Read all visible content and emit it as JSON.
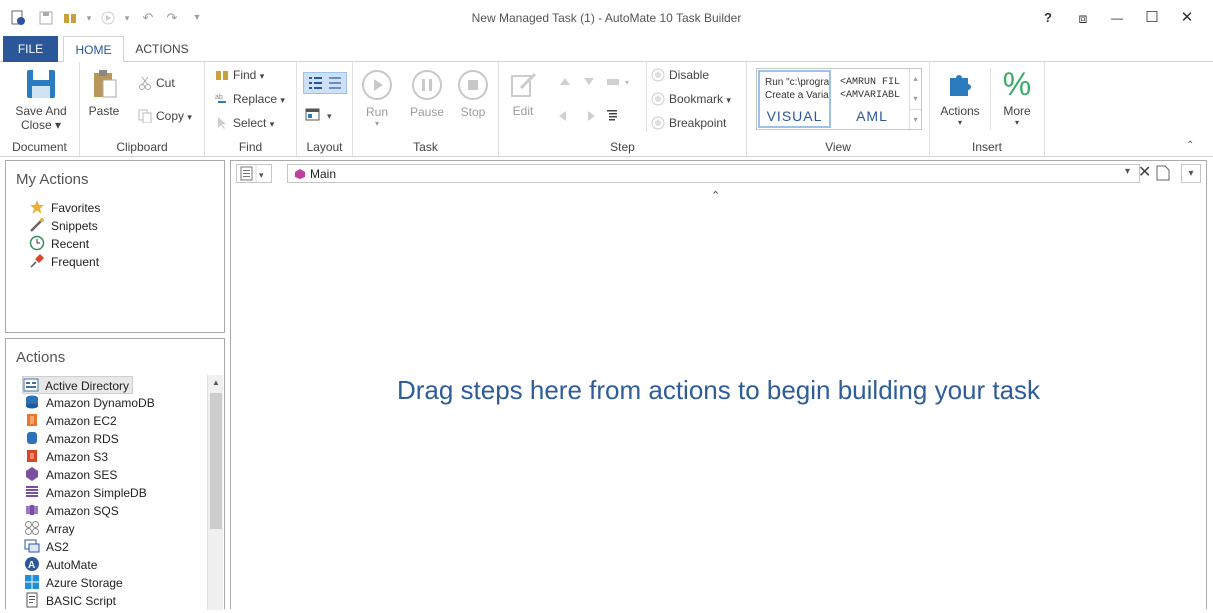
{
  "window": {
    "title": "New Managed Task (1) - AutoMate 10 Task Builder"
  },
  "controls": {
    "help": "?",
    "restore_layout": "⧈",
    "minimize": "—",
    "maximize": "☐",
    "close": "✕"
  },
  "tabs": {
    "file": "FILE",
    "home": "HOME",
    "actions": "ACTIONS"
  },
  "ribbon": {
    "document": {
      "label": "Document",
      "save_line1": "Save And",
      "save_line2": "Close ▾"
    },
    "clipboard": {
      "label": "Clipboard",
      "paste": "Paste",
      "cut": "Cut",
      "copy": "Copy"
    },
    "find": {
      "label": "Find",
      "find": "Find",
      "replace": "Replace",
      "select": "Select"
    },
    "layout": {
      "label": "Layout"
    },
    "task": {
      "label": "Task",
      "run": "Run",
      "pause": "Pause",
      "stop": "Stop"
    },
    "step": {
      "label": "Step",
      "edit": "Edit",
      "disable": "Disable",
      "bookmark": "Bookmark",
      "breakpoint": "Breakpoint"
    },
    "view": {
      "label": "View",
      "visual_line1": "Run \"c:\\progra",
      "visual_line2": "Create a Varia",
      "visual": "VISUAL",
      "aml_line1": "<AMRUN FIL",
      "aml_line2": "<AMVARIABL",
      "aml": "AML"
    },
    "insert": {
      "label": "Insert",
      "actions": "Actions",
      "more": "More"
    }
  },
  "my_actions": {
    "title": "My Actions",
    "items": [
      {
        "label": "Favorites",
        "icon": "star-icon"
      },
      {
        "label": "Snippets",
        "icon": "wand-icon"
      },
      {
        "label": "Recent",
        "icon": "clock-icon"
      },
      {
        "label": "Frequent",
        "icon": "pin-icon"
      }
    ]
  },
  "actions_panel": {
    "title": "Actions",
    "items": [
      {
        "label": "Active Directory",
        "color": "#4a6fa5"
      },
      {
        "label": "Amazon DynamoDB",
        "color": "#2d72b8"
      },
      {
        "label": "Amazon EC2",
        "color": "#e8772e"
      },
      {
        "label": "Amazon RDS",
        "color": "#2d72b8"
      },
      {
        "label": "Amazon S3",
        "color": "#d9472b"
      },
      {
        "label": "Amazon SES",
        "color": "#7b4fa0"
      },
      {
        "label": "Amazon SimpleDB",
        "color": "#7b4fa0"
      },
      {
        "label": "Amazon SQS",
        "color": "#7b4fa0"
      },
      {
        "label": "Array",
        "color": "#8a8a8a"
      },
      {
        "label": "AS2",
        "color": "#2b579a"
      },
      {
        "label": "AutoMate",
        "color": "#2b579a"
      },
      {
        "label": "Azure Storage",
        "color": "#1e90d8"
      },
      {
        "label": "BASIC Script",
        "color": "#555555"
      }
    ]
  },
  "workspace": {
    "breadcrumb": "Main",
    "placeholder": "Drag steps here from actions to begin building your task"
  }
}
